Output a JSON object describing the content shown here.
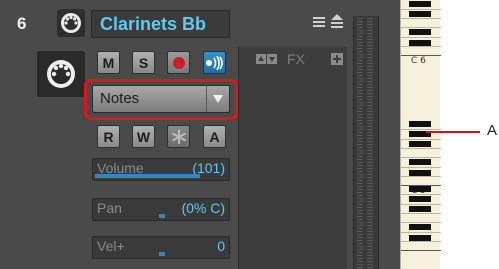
{
  "track": {
    "number": "6",
    "name": "Clarinets Bb"
  },
  "buttons": {
    "mute": "M",
    "solo": "S",
    "read": "R",
    "write": "W",
    "arm": "A"
  },
  "instrument_dropdown": {
    "value": "Notes"
  },
  "fx": {
    "label": "FX"
  },
  "sliders": [
    {
      "label": "Volume",
      "value": "(101)",
      "level": 0.78
    },
    {
      "label": "Pan",
      "value": "(0% C)",
      "level": 0.5
    },
    {
      "label": "Vel+",
      "value": "0",
      "level": 0.5
    }
  ],
  "keyboard": {
    "octave_labels": [
      "C 6",
      "C 5"
    ]
  },
  "callout": {
    "label": "A"
  },
  "colors": {
    "highlight": "#e2141b",
    "accent": "#61c8f0",
    "record": "#c8202a",
    "callout_line": "#d0141a"
  },
  "icons": [
    "midi-port-icon",
    "midi-output-icon",
    "menu-icon",
    "collapse-icon",
    "record-icon",
    "input-echo-icon",
    "automation-star-icon",
    "dropdown-arrow-icon",
    "fx-arrows-icon",
    "fx-add-icon"
  ]
}
